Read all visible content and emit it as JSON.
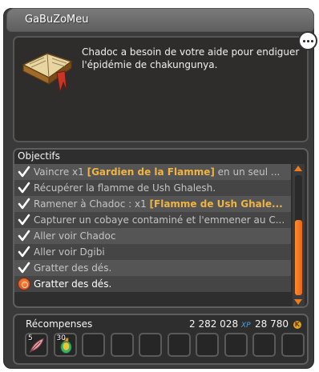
{
  "window": {
    "title": "GaBuZoMeu"
  },
  "quest": {
    "description": "Chadoc a besoin de votre aide pour endiguer l'épidémie de chakungunya.",
    "icon": "open-book-icon"
  },
  "objectives": {
    "header": "Objectifs",
    "items": [
      {
        "state": "done",
        "prefix": "Vaincre x1 ",
        "highlight": "[Gardien de la Flamme]",
        "suffix": " en un seul ..."
      },
      {
        "state": "done",
        "prefix": "Récupérer la flamme de Ush Ghalesh.",
        "highlight": "",
        "suffix": ""
      },
      {
        "state": "done",
        "prefix": "Ramener à Chadoc : x1 ",
        "highlight": "[Flamme de Ush Ghale...",
        "suffix": ""
      },
      {
        "state": "done",
        "prefix": "Capturer un cobaye contaminé et l'emmener au C...",
        "highlight": "",
        "suffix": ""
      },
      {
        "state": "done",
        "prefix": "Aller voir Chadoc",
        "highlight": "",
        "suffix": ""
      },
      {
        "state": "done",
        "prefix": "Aller voir Dgibi",
        "highlight": "",
        "suffix": ""
      },
      {
        "state": "done",
        "prefix": "Gratter des dés.",
        "highlight": "",
        "suffix": ""
      },
      {
        "state": "active",
        "prefix": "Gratter des dés.",
        "highlight": "",
        "suffix": ""
      }
    ]
  },
  "rewards": {
    "header": "Récompenses",
    "xp_value": "2 282 028",
    "xp_label": "XP",
    "kamas_value": "28 780",
    "kama_symbol": "K",
    "slots": [
      {
        "qty": "5",
        "icon": "feather-item-icon"
      },
      {
        "qty": "30",
        "icon": "potion-item-icon"
      },
      {
        "qty": "",
        "icon": ""
      },
      {
        "qty": "",
        "icon": ""
      },
      {
        "qty": "",
        "icon": ""
      },
      {
        "qty": "",
        "icon": ""
      },
      {
        "qty": "",
        "icon": ""
      },
      {
        "qty": "",
        "icon": ""
      },
      {
        "qty": "",
        "icon": ""
      },
      {
        "qty": "",
        "icon": ""
      }
    ]
  },
  "colors": {
    "highlight": "#f0b443",
    "accent": "#f07a1e",
    "xp": "#4aa3e8"
  }
}
